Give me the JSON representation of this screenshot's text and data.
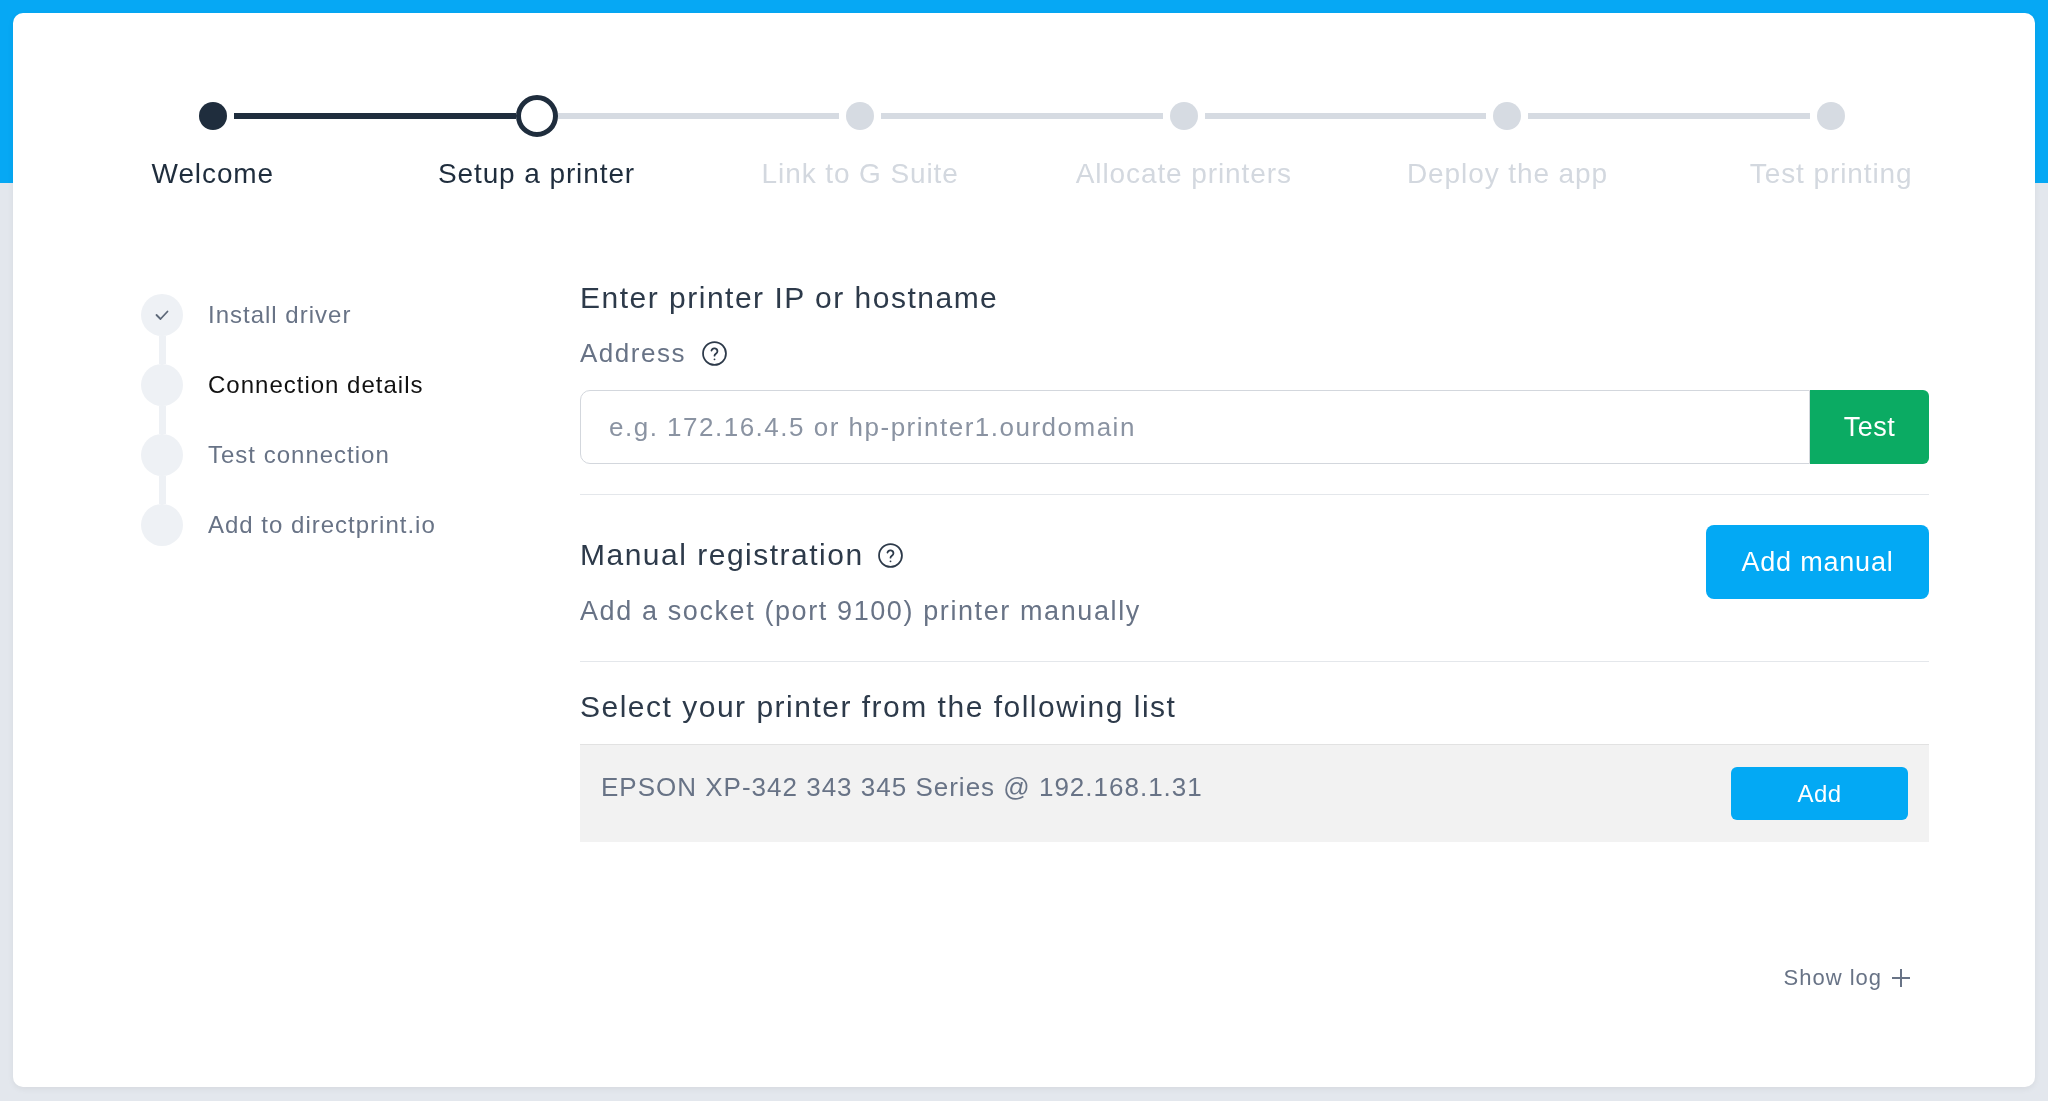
{
  "steps": [
    {
      "label": "Welcome",
      "completed": true,
      "current": false
    },
    {
      "label": "Setup a printer",
      "completed": false,
      "current": true
    },
    {
      "label": "Link to G Suite",
      "completed": false,
      "current": false
    },
    {
      "label": "Allocate printers",
      "completed": false,
      "current": false
    },
    {
      "label": "Deploy the app",
      "completed": false,
      "current": false
    },
    {
      "label": "Test printing",
      "completed": false,
      "current": false
    }
  ],
  "substeps": [
    {
      "label": "Install driver",
      "completed": true,
      "current": false
    },
    {
      "label": "Connection details",
      "completed": false,
      "current": true
    },
    {
      "label": "Test connection",
      "completed": false,
      "current": false
    },
    {
      "label": "Add to directprint.io",
      "completed": false,
      "current": false
    }
  ],
  "address_section": {
    "title": "Enter printer IP or hostname",
    "label": "Address",
    "input": {
      "placeholder": "e.g. 172.16.4.5 or hp-printer1.ourdomain"
    },
    "button": "Test"
  },
  "manual_registration": {
    "title": "Manual registration",
    "description": "Add a socket (port 9100) printer manually",
    "button": "Add manual"
  },
  "printer_list": {
    "title": "Select your printer from the following list",
    "printers": [
      {
        "name": "EPSON XP-342 343 345 Series @ 192.168.1.31",
        "button": "Add"
      }
    ]
  },
  "show_log": "Show log"
}
